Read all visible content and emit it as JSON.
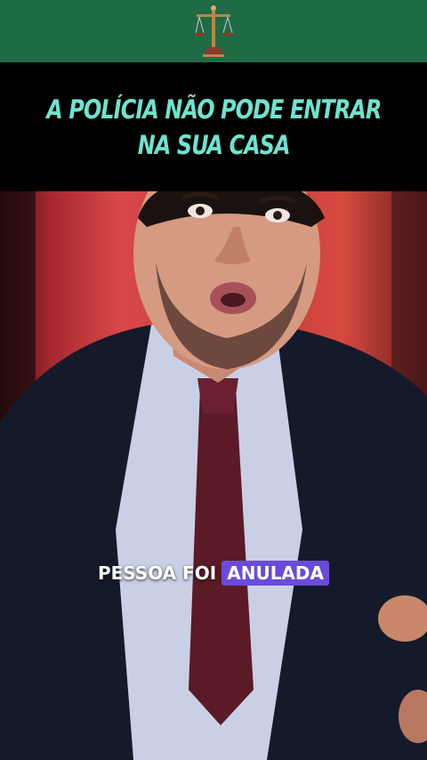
{
  "header": {
    "logo_icon": "scales-of-justice-icon",
    "background": "#1f6b45"
  },
  "title": {
    "line1": "A POLÍCIA NÃO PODE ENTRAR",
    "line2": "NA SUA CASA",
    "color": "#6fe3cf"
  },
  "caption": {
    "text": "PESSOA FOI",
    "highlight": "ANULADA",
    "highlight_color": "#6a4bd8"
  }
}
